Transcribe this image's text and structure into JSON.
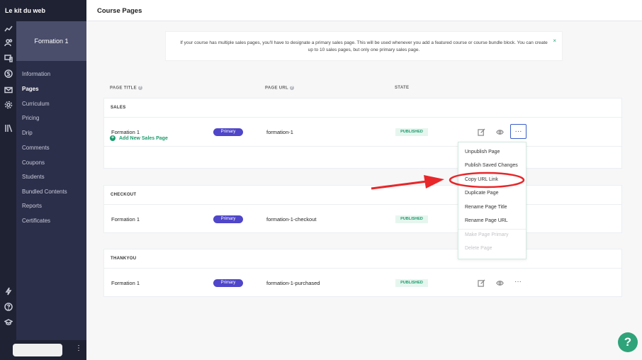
{
  "brand": "Le kit du web",
  "header": {
    "title": "Course Pages"
  },
  "course": {
    "title": "Formation 1"
  },
  "nav": [
    {
      "label": "Information",
      "active": false
    },
    {
      "label": "Pages",
      "active": true
    },
    {
      "label": "Curriculum",
      "active": false
    },
    {
      "label": "Pricing",
      "active": false
    },
    {
      "label": "Drip",
      "active": false
    },
    {
      "label": "Comments",
      "active": false
    },
    {
      "label": "Coupons",
      "active": false
    },
    {
      "label": "Students",
      "active": false
    },
    {
      "label": "Bundled Contents",
      "active": false
    },
    {
      "label": "Reports",
      "active": false
    },
    {
      "label": "Certificates",
      "active": false
    }
  ],
  "banner": {
    "text": "If your course has multiple sales pages, you'll have to designate a primary sales page. This will be used whenever you add a featured course or course bundle block. You can create up to 10 sales pages, but only one primary sales page.",
    "close": "×"
  },
  "columns": {
    "title": "PAGE TITLE",
    "url": "PAGE URL",
    "state": "STATE",
    "help": "?"
  },
  "sections": {
    "sales": {
      "label": "SALES",
      "row": {
        "title": "Formation 1",
        "badge": "Primary",
        "url": "formation-1",
        "state": "PUBLISHED"
      },
      "add_link": "Add New Sales Page"
    },
    "checkout": {
      "label": "CHECKOUT",
      "row": {
        "title": "Formation 1",
        "badge": "Primary",
        "url": "formation-1-checkout",
        "state": "PUBLISHED"
      }
    },
    "thankyou": {
      "label": "THANKYOU",
      "row": {
        "title": "Formation 1",
        "badge": "Primary",
        "url": "formation-1-purchased",
        "state": "PUBLISHED"
      }
    }
  },
  "menu": {
    "items": [
      {
        "label": "Unpublish Page",
        "enabled": true
      },
      {
        "label": "Publish Saved Changes",
        "enabled": true
      },
      {
        "label": "Copy URL Link",
        "enabled": true
      },
      {
        "label": "Duplicate Page",
        "enabled": true
      },
      {
        "label": "Rename Page Title",
        "enabled": true
      },
      {
        "label": "Rename Page URL",
        "enabled": true
      },
      {
        "label": "Make Page Primary",
        "enabled": false
      },
      {
        "label": "Delete Page",
        "enabled": false
      }
    ]
  },
  "help_button": "?",
  "icons": {
    "rail": [
      "chart-icon",
      "users-icon",
      "devices-icon",
      "dollar-icon",
      "mail-icon",
      "gear-icon",
      "library-icon",
      "bolt-icon",
      "help-circle-icon",
      "graduation-cap-icon"
    ],
    "row_actions": [
      "edit-icon",
      "eye-icon",
      "more-icon"
    ]
  },
  "colors": {
    "sidebar": "#2c2f4a",
    "rail": "#1f2233",
    "primary_badge": "#4f46c9",
    "published": "#1c9c6e",
    "annotation": "#e8272a",
    "help": "#2fa37a"
  }
}
